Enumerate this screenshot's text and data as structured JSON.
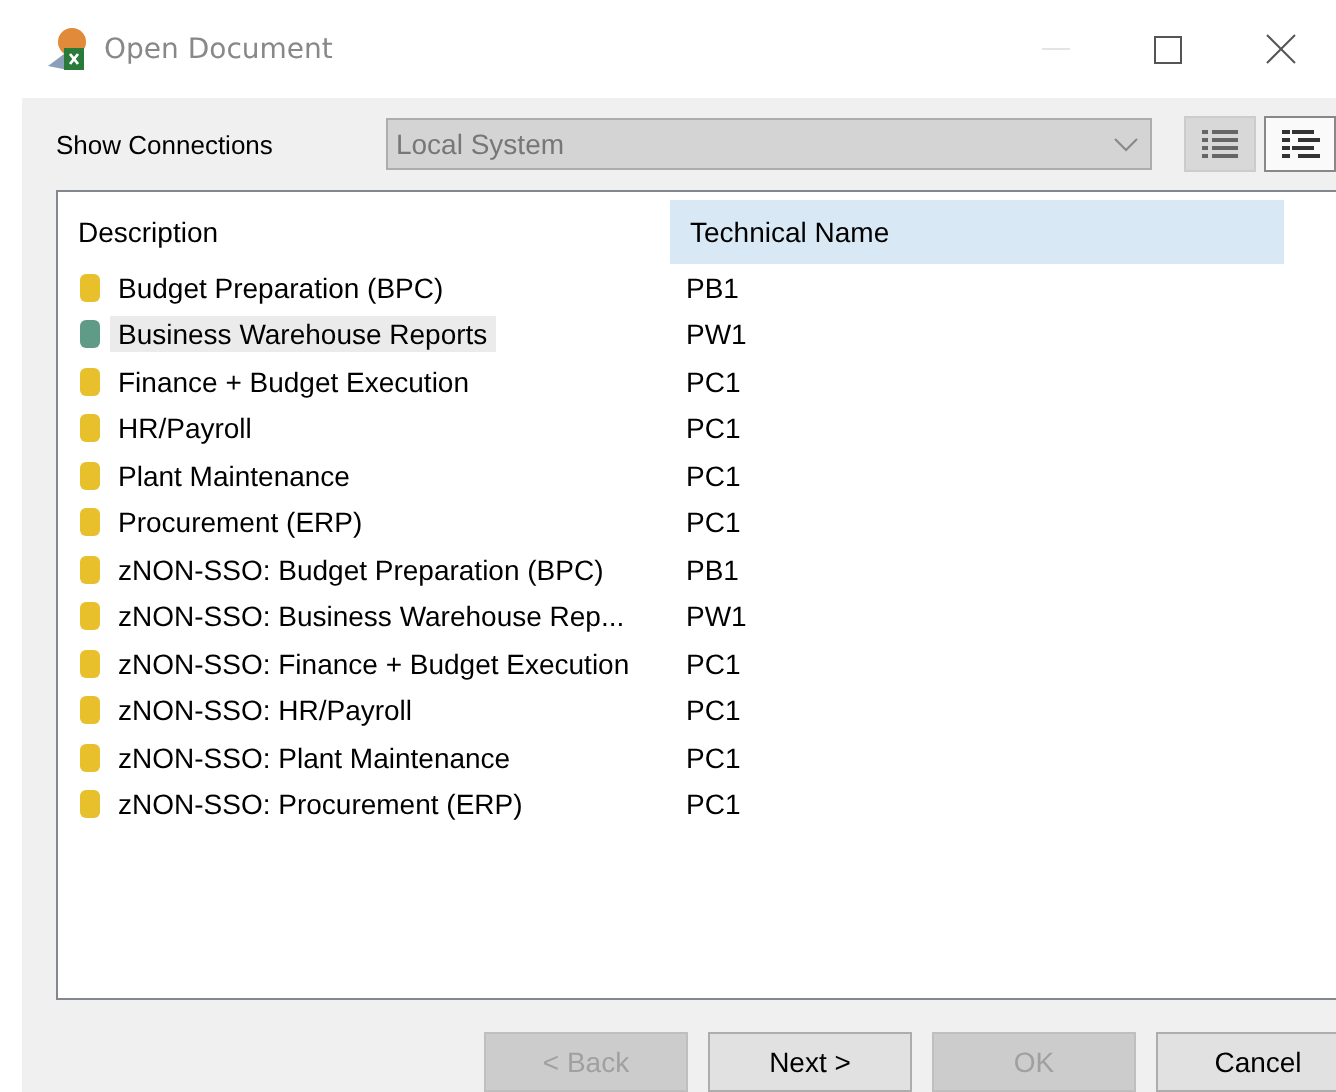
{
  "window": {
    "title": "Open Document",
    "minimize_disabled": true
  },
  "show_connections": {
    "label": "Show Connections",
    "value": "Local System",
    "disabled": true
  },
  "view_buttons": [
    {
      "kind": "list",
      "selected": false
    },
    {
      "kind": "details",
      "selected": true
    }
  ],
  "table": {
    "columns": [
      "Description",
      "Technical Name"
    ],
    "rows": [
      {
        "description": "Budget Preparation (BPC)",
        "technical_name": "PB1",
        "color": "#e8c02c",
        "selected": false
      },
      {
        "description": "Business Warehouse Reports",
        "technical_name": "PW1",
        "color": "#5f9b86",
        "selected": true
      },
      {
        "description": "Finance + Budget Execution",
        "technical_name": "PC1",
        "color": "#e8c02c",
        "selected": false
      },
      {
        "description": "HR/Payroll",
        "technical_name": "PC1",
        "color": "#e8c02c",
        "selected": false
      },
      {
        "description": "Plant Maintenance",
        "technical_name": "PC1",
        "color": "#e8c02c",
        "selected": false
      },
      {
        "description": "Procurement (ERP)",
        "technical_name": "PC1",
        "color": "#e8c02c",
        "selected": false
      },
      {
        "description": "zNON-SSO: Budget Preparation (BPC)",
        "technical_name": "PB1",
        "color": "#e8c02c",
        "selected": false
      },
      {
        "description": "zNON-SSO: Business Warehouse Rep...",
        "technical_name": "PW1",
        "color": "#e8c02c",
        "selected": false
      },
      {
        "description": "zNON-SSO: Finance + Budget Execution",
        "technical_name": "PC1",
        "color": "#e8c02c",
        "selected": false
      },
      {
        "description": "zNON-SSO: HR/Payroll",
        "technical_name": "PC1",
        "color": "#e8c02c",
        "selected": false
      },
      {
        "description": "zNON-SSO: Plant Maintenance",
        "technical_name": "PC1",
        "color": "#e8c02c",
        "selected": false
      },
      {
        "description": "zNON-SSO: Procurement (ERP)",
        "technical_name": "PC1",
        "color": "#e8c02c",
        "selected": false
      }
    ]
  },
  "buttons": [
    {
      "label": "< Back",
      "disabled": true
    },
    {
      "label": "Next >",
      "disabled": false
    },
    {
      "label": "OK",
      "disabled": true
    },
    {
      "label": "Cancel",
      "disabled": false
    }
  ]
}
